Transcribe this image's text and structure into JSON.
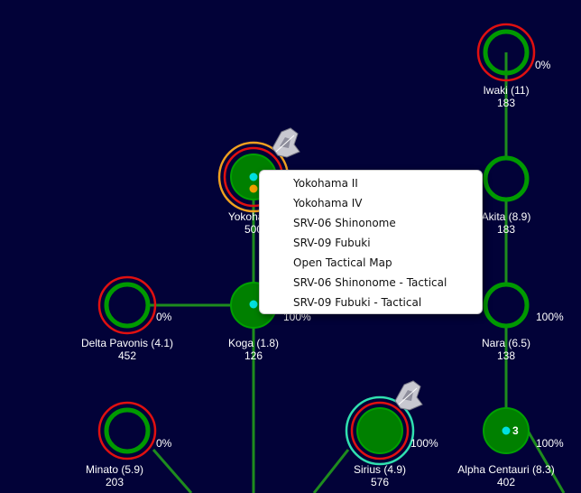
{
  "colors": {
    "background": "#020238",
    "route": "#1e8c1e",
    "system_fill": "#008000",
    "system_ring": "#00a000",
    "hostile_ring": "#e01010",
    "selected_ring": "#f0a020",
    "friendly_ring": "#30e0b0",
    "fleet_cyan": "#00e0e0",
    "fleet_orange": "#f0a000"
  },
  "systems": [
    {
      "id": "iwaki",
      "name": "Iwaki  (11)",
      "value": "183",
      "percent": "0%"
    },
    {
      "id": "yokohama",
      "name": "Yokohama",
      "value": "500"
    },
    {
      "id": "akita",
      "name": "Akita  (8.9)",
      "value": "183"
    },
    {
      "id": "delta-pavonis",
      "name": "Delta Pavonis  (4.1)",
      "value": "452",
      "percent": "0%"
    },
    {
      "id": "koga",
      "name": "Koga  (1.8)",
      "value": "126",
      "percent": "100%"
    },
    {
      "id": "nara",
      "name": "Nara  (6.5)",
      "value": "138",
      "percent": "100%"
    },
    {
      "id": "minato",
      "name": "Minato  (5.9)",
      "value": "203",
      "percent": "0%"
    },
    {
      "id": "sirius",
      "name": "Sirius  (4.9)",
      "value": "576",
      "percent": "100%"
    },
    {
      "id": "alpha-centauri",
      "name": "Alpha Centauri  (8.3)",
      "value": "402",
      "percent": "100%",
      "count": "3"
    }
  ],
  "context_menu": {
    "items": [
      "Yokohama II",
      "Yokohama IV",
      "SRV-06 Shinonome",
      "SRV-09 Fubuki",
      "Open Tactical Map",
      "SRV-06 Shinonome - Tactical",
      "SRV-09 Fubuki - Tactical"
    ]
  },
  "icons": {
    "ship": "starship-icon"
  }
}
